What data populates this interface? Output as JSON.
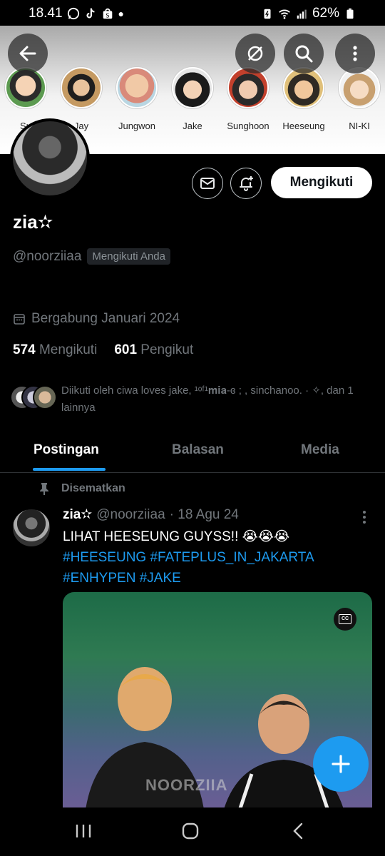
{
  "status_bar": {
    "time": "18.41",
    "battery": "62%"
  },
  "header": {
    "stories": [
      {
        "label": "Su"
      },
      {
        "label": "Jay"
      },
      {
        "label": "Jungwon"
      },
      {
        "label": "Jake"
      },
      {
        "label": "Sunghoon"
      },
      {
        "label": "Heeseung"
      },
      {
        "label": "NI-KI"
      }
    ]
  },
  "profile": {
    "display_name": "zia✫",
    "handle": "@noorziiaa",
    "follows_you": "Mengikuti Anda",
    "follow_button": "Mengikuti",
    "joined": "Bergabung Januari 2024",
    "following_count": "574",
    "following_label": "Mengikuti",
    "followers_count": "601",
    "followers_label": "Pengikut",
    "followed_by_text": "Diikuti oleh ciwa loves jake, ¹ᵒᶠ¹𝐦𝐢𝐚-ɞ ; , sinchanoo. · ✧, dan 1 lainnya"
  },
  "tabs": [
    {
      "label": "Postingan",
      "active": true
    },
    {
      "label": "Balasan",
      "active": false
    },
    {
      "label": "Media",
      "active": false
    }
  ],
  "post": {
    "pinned_label": "Disematkan",
    "author_name": "zia✫",
    "author_handle": "@noorziiaa",
    "date": "· 18 Agu 24",
    "text": "LIHAT HEESEUNG GUYSS!! 😭😭😭",
    "hashtags_line1": "#HEESEUNG #FATEPLUS_IN_JAKARTA",
    "hashtags_line2": "#ENHYPEN #JAKE",
    "media_watermark": "NOORZIIA"
  },
  "colors": {
    "accent": "#1d9bf0",
    "background": "#000000",
    "muted_text": "#71767b"
  }
}
